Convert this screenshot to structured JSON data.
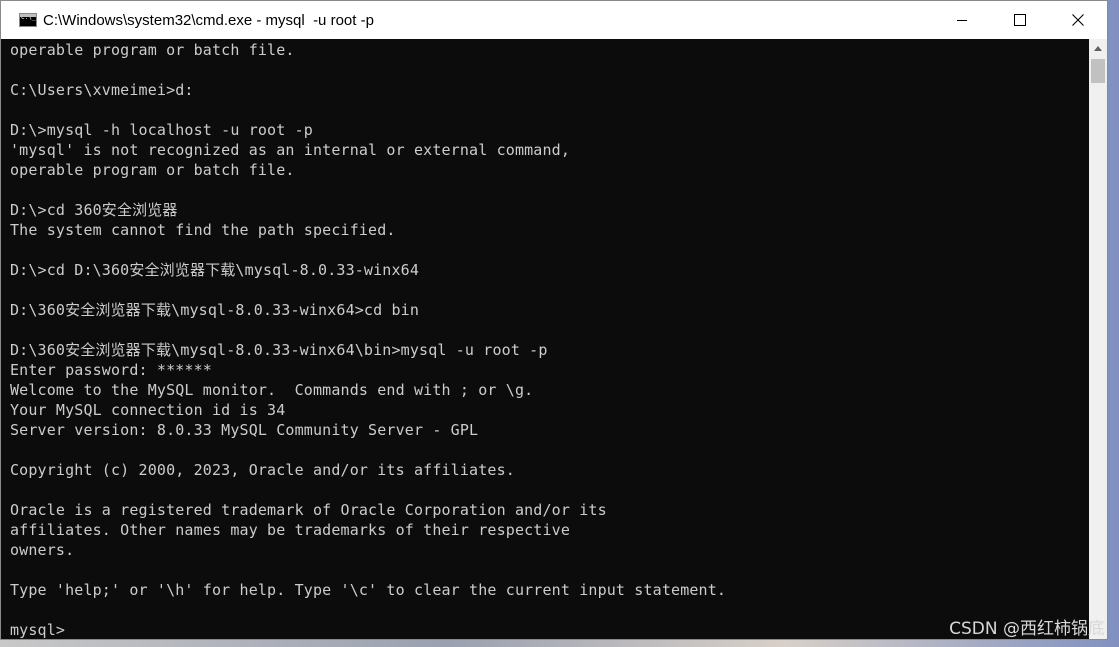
{
  "window": {
    "title": "C:\\Windows\\system32\\cmd.exe - mysql  -u root -p",
    "icon": "cmd-icon",
    "controls": [
      "minimize-icon",
      "maximize-icon",
      "close-icon"
    ]
  },
  "console": {
    "lines": [
      "operable program or batch file.",
      "",
      "C:\\Users\\xvmeimei>d:",
      "",
      "D:\\>mysql -h localhost -u root -p",
      "'mysql' is not recognized as an internal or external command,",
      "operable program or batch file.",
      "",
      "D:\\>cd 360安全浏览器",
      "The system cannot find the path specified.",
      "",
      "D:\\>cd D:\\360安全浏览器下载\\mysql-8.0.33-winx64",
      "",
      "D:\\360安全浏览器下载\\mysql-8.0.33-winx64>cd bin",
      "",
      "D:\\360安全浏览器下载\\mysql-8.0.33-winx64\\bin>mysql -u root -p",
      "Enter password: ******",
      "Welcome to the MySQL monitor.  Commands end with ; or \\g.",
      "Your MySQL connection id is 34",
      "Server version: 8.0.33 MySQL Community Server - GPL",
      "",
      "Copyright (c) 2000, 2023, Oracle and/or its affiliates.",
      "",
      "Oracle is a registered trademark of Oracle Corporation and/or its",
      "affiliates. Other names may be trademarks of their respective",
      "owners.",
      "",
      "Type 'help;' or '\\h' for help. Type '\\c' to clear the current input statement.",
      "",
      "mysql>"
    ],
    "text_color": "#cccccc",
    "background": "#0c0c0c"
  },
  "watermark": "CSDN @西红柿锅底"
}
